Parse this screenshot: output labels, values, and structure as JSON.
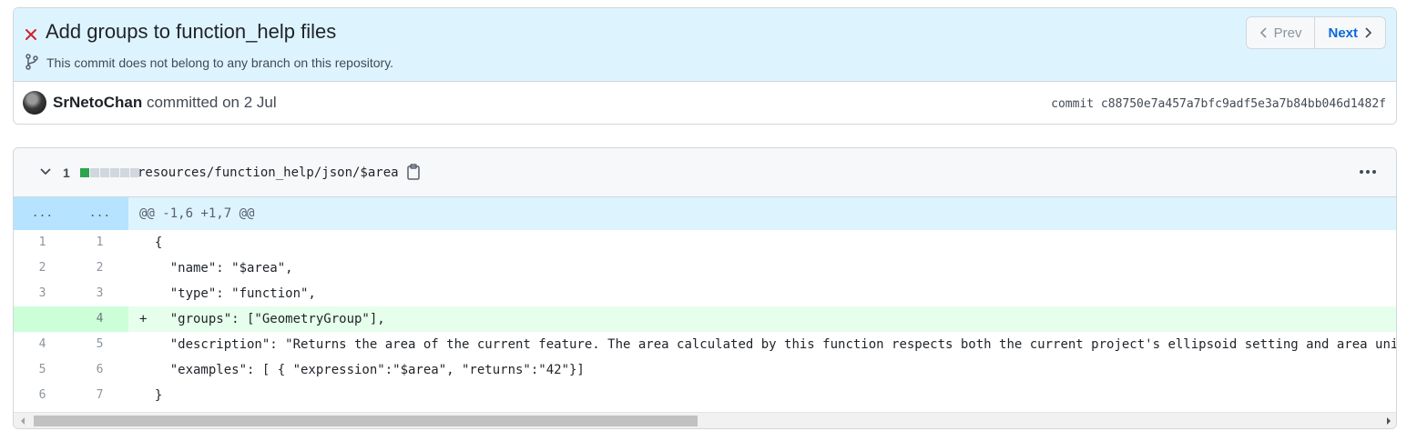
{
  "commit": {
    "title": "Add groups to function_help files",
    "branch_note": "This commit does not belong to any branch on this repository.",
    "nav": {
      "prev_label": "Prev",
      "next_label": "Next"
    },
    "author": "SrNetoChan",
    "committed_text": "committed on 2 Jul",
    "sha_label": "commit c88750e7a457a7bfc9adf5e3a7b84bb046d1482f",
    "status_color": "#cf222e"
  },
  "file": {
    "change_count": "1",
    "diffstat": [
      "add",
      "neutral",
      "neutral",
      "neutral",
      "neutral",
      "neutral"
    ],
    "path": "resources/function_help/json/$area",
    "hunk": {
      "old_ln": "...",
      "new_ln": "...",
      "header": "@@ -1,6 +1,7 @@"
    },
    "lines": [
      {
        "old": "1",
        "new": "1",
        "text": "  {",
        "type": "context"
      },
      {
        "old": "2",
        "new": "2",
        "text": "    \"name\": \"$area\",",
        "type": "context"
      },
      {
        "old": "3",
        "new": "3",
        "text": "    \"type\": \"function\",",
        "type": "context"
      },
      {
        "old": "",
        "new": "4",
        "text": "+   \"groups\": [\"GeometryGroup\"],",
        "type": "add"
      },
      {
        "old": "4",
        "new": "5",
        "text": "    \"description\": \"Returns the area of the current feature. The area calculated by this function respects both the current project's ellipsoid setting and area unit s",
        "type": "context"
      },
      {
        "old": "5",
        "new": "6",
        "text": "    \"examples\": [ { \"expression\":\"$area\", \"returns\":\"42\"}]",
        "type": "context"
      },
      {
        "old": "6",
        "new": "7",
        "text": "  }",
        "type": "context"
      }
    ]
  }
}
